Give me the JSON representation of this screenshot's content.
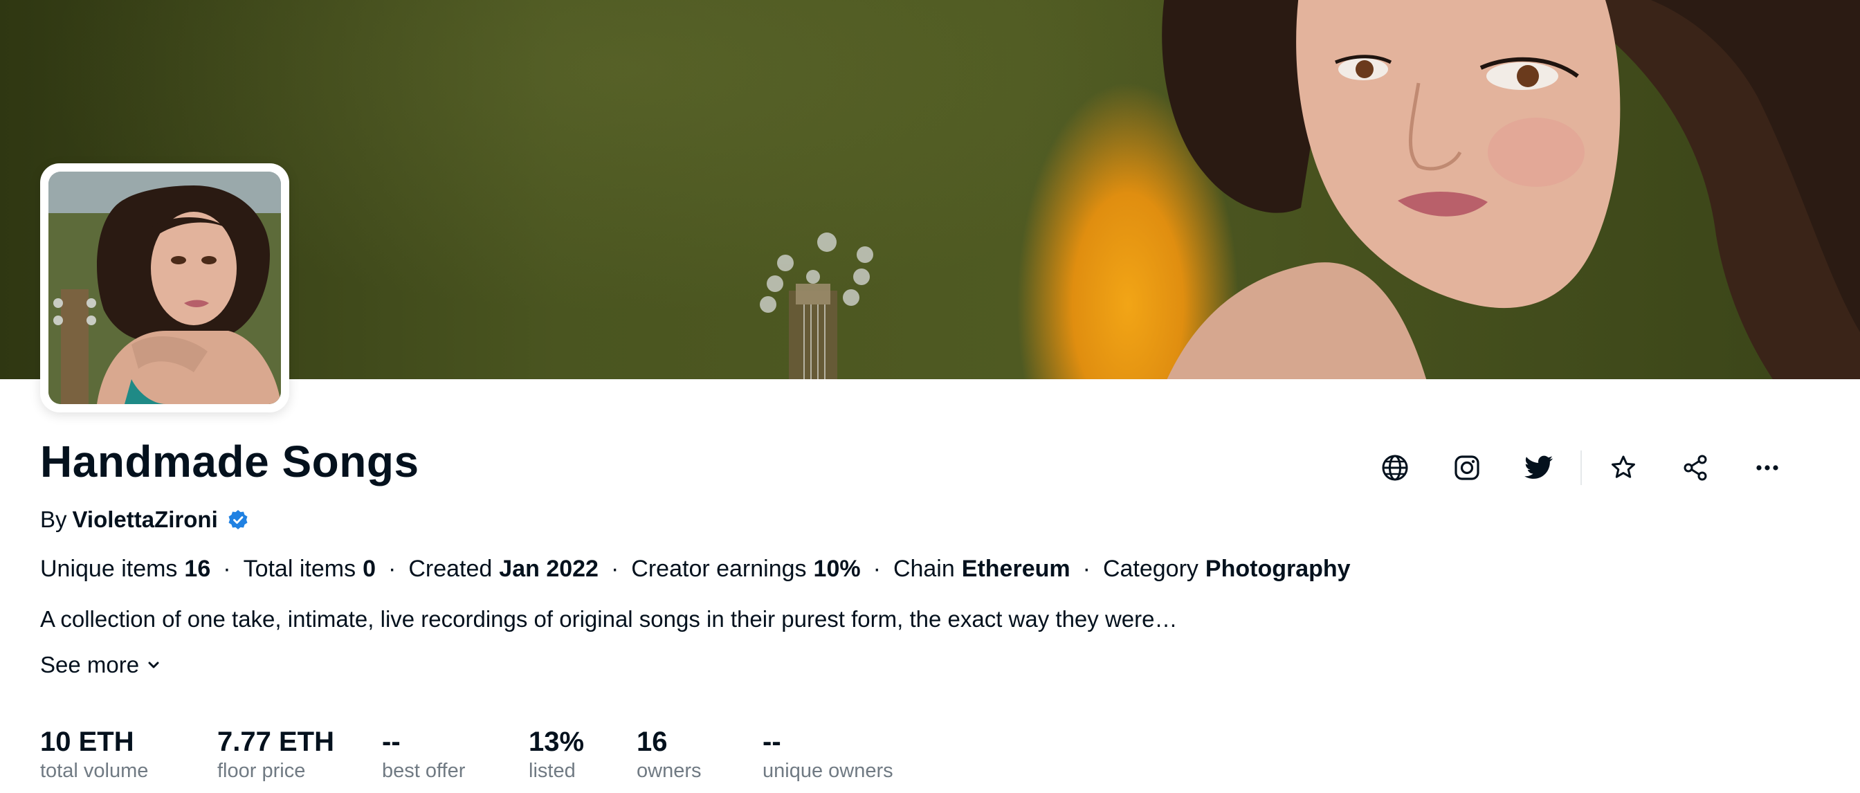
{
  "banner": {
    "alt": "collection-banner"
  },
  "collection": {
    "title": "Handmade Songs",
    "by_prefix": "By",
    "creator": "ViolettaZironi",
    "description": "A collection of one take, intimate, live recordings of original songs in their purest form, the exact way they were…",
    "see_more": "See more"
  },
  "meta": {
    "unique_items_label": "Unique items",
    "unique_items_value": "16",
    "total_items_label": "Total items",
    "total_items_value": "0",
    "created_label": "Created",
    "created_value": "Jan 2022",
    "earnings_label": "Creator earnings",
    "earnings_value": "10%",
    "chain_label": "Chain",
    "chain_value": "Ethereum",
    "category_label": "Category",
    "category_value": "Photography",
    "separator": "·"
  },
  "stats": [
    {
      "value": "10 ETH",
      "label": "total volume"
    },
    {
      "value": "7.77 ETH",
      "label": "floor price"
    },
    {
      "value": "--",
      "label": "best offer"
    },
    {
      "value": "13%",
      "label": "listed"
    },
    {
      "value": "16",
      "label": "owners"
    },
    {
      "value": "--",
      "label": "unique owners"
    }
  ],
  "actions": {
    "icons": [
      "globe-icon",
      "instagram-icon",
      "twitter-icon",
      "star-icon",
      "share-icon",
      "more-icon"
    ]
  },
  "colors": {
    "text_primary": "#04111d",
    "text_secondary": "#707a83",
    "verified_blue": "#2081e2"
  }
}
